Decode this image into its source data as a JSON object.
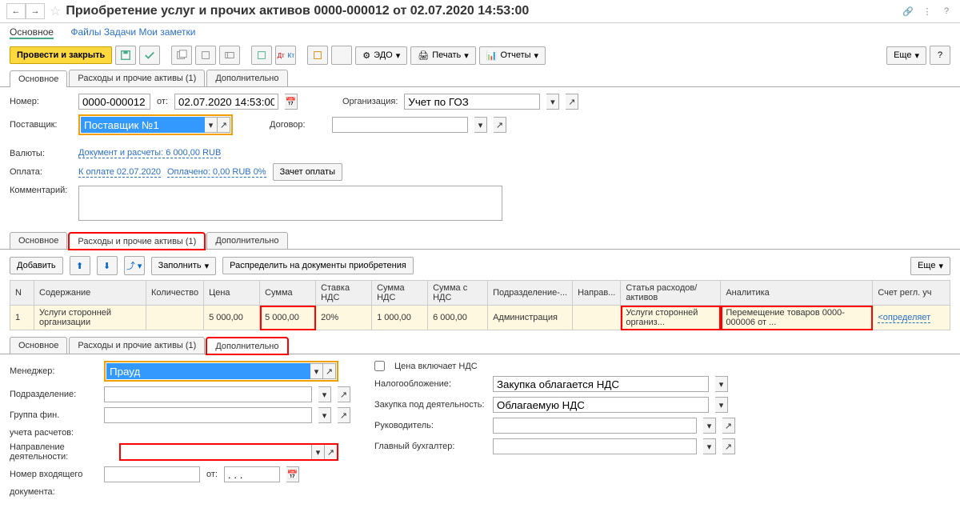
{
  "header": {
    "title": "Приобретение услуг и прочих активов 0000-000012 от 02.07.2020 14:53:00"
  },
  "linkbar": {
    "main": "Основное",
    "files": "Файлы",
    "tasks": "Задачи",
    "notes": "Мои заметки"
  },
  "toolbar": {
    "post_close": "Провести и закрыть",
    "edo": "ЭДО",
    "print": "Печать",
    "reports": "Отчеты",
    "more": "Еще"
  },
  "tabs1": {
    "t1": "Основное",
    "t2": "Расходы и прочие активы (1)",
    "t3": "Дополнительно"
  },
  "form1": {
    "number_lbl": "Номер:",
    "number": "0000-000012",
    "from_lbl": "от:",
    "date": "02.07.2020 14:53:00",
    "org_lbl": "Организация:",
    "org": "Учет по ГОЗ",
    "supplier_lbl": "Поставщик:",
    "supplier": "Поставщик №1",
    "contract_lbl": "Договор:",
    "currency_lbl": "Валюты:",
    "currency_link": "Документ и расчеты: 6 000,00 RUB",
    "payment_lbl": "Оплата:",
    "pay_link1": "К оплате 02.07.2020",
    "pay_link2": "Оплачено: 0,00 RUB 0%",
    "offset_btn": "Зачет оплаты",
    "comment_lbl": "Комментарий:"
  },
  "tabs2": {
    "t1": "Основное",
    "t2": "Расходы и прочие активы (1)",
    "t3": "Дополнительно"
  },
  "toolbar2": {
    "add": "Добавить",
    "fill": "Заполнить",
    "distribute": "Распределить на документы приобретения",
    "more": "Еще"
  },
  "table": {
    "h": {
      "n": "N",
      "content": "Содержание",
      "qty": "Количество",
      "price": "Цена",
      "sum": "Сумма",
      "vat_rate": "Ставка НДС",
      "vat_sum": "Сумма НДС",
      "sum_vat": "Сумма с НДС",
      "dept": "Подразделение-...",
      "dir": "Направ...",
      "article": "Статья расходов/активов",
      "analytics": "Аналитика",
      "acc": "Счет регл. уч"
    },
    "row": {
      "n": "1",
      "content": "Услуги сторонней организации",
      "qty": "",
      "price": "5 000,00",
      "sum": "5 000,00",
      "vat_rate": "20%",
      "vat_sum": "1 000,00",
      "sum_vat": "6 000,00",
      "dept": "Администрация",
      "dir": "",
      "article": "Услуги сторонней организ...",
      "analytics": "Перемещение товаров 0000-000006 от ...",
      "acc": "<определяет"
    }
  },
  "tabs3": {
    "t1": "Основное",
    "t2": "Расходы и прочие активы (1)",
    "t3": "Дополнительно"
  },
  "form2": {
    "manager_lbl": "Менеджер:",
    "manager": "Прауд",
    "dept_lbl": "Подразделение:",
    "fin_lbl": "Группа фин.",
    "fin_lbl2": "учета расчетов:",
    "dir_lbl": "Направление деятельности:",
    "inc_lbl": "Номер входящего",
    "inc_lbl2": "документа:",
    "inc_from": "от:",
    "inc_date": ". . .",
    "vat_inc": "Цена включает НДС",
    "tax_lbl": "Налогообложение:",
    "tax": "Закупка облагается НДС",
    "activ_lbl": "Закупка под деятельность:",
    "activ": "Облагаемую НДС",
    "chief_lbl": "Руководитель:",
    "acc_lbl": "Главный бухгалтер:"
  }
}
